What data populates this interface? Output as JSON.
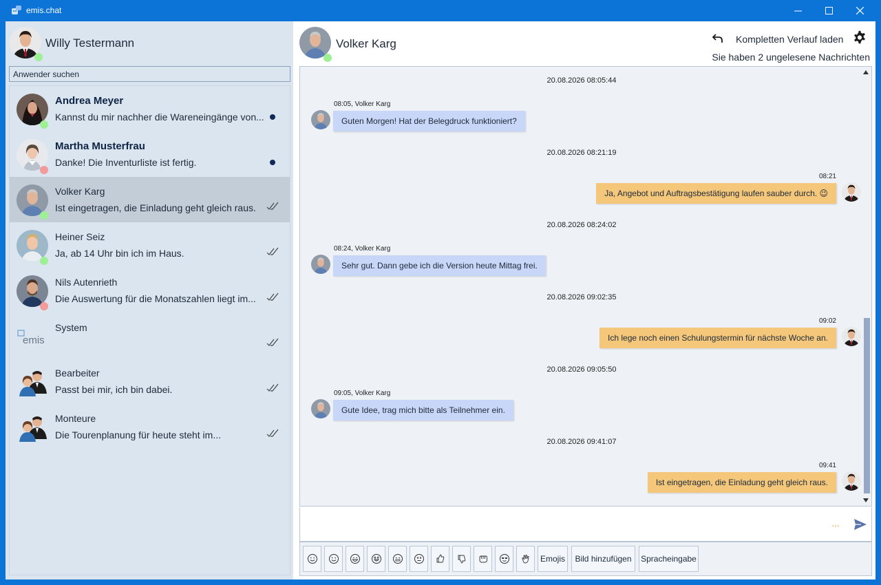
{
  "window": {
    "title": "emis.chat"
  },
  "colors": {
    "titlebar": "#0b74d6",
    "sidebar": "#dbe5f0",
    "incoming_bubble": "#c8d6f7",
    "outgoing_bubble": "#f5c77a",
    "online": "#9ef094",
    "offline": "#f49a9a",
    "unread_dot": "#0f2a57"
  },
  "me": {
    "name": "Willy Testermann",
    "status": "online"
  },
  "search": {
    "placeholder": "Anwender suchen"
  },
  "contacts": [
    {
      "name": "Andrea Meyer",
      "message": "Kannst du mir nachher die Wareneingänge von...",
      "status": "online",
      "unread": true,
      "bold": true,
      "avatar": "woman-dark"
    },
    {
      "name": "Martha Musterfrau",
      "message": "Danke! Die Inventurliste ist fertig.",
      "status": "offline",
      "unread": true,
      "bold": true,
      "avatar": "woman-light"
    },
    {
      "name": "Volker Karg",
      "message": "Ist eingetragen, die Einladung geht gleich raus.",
      "status": "online",
      "unread": false,
      "selected": true,
      "avatar": "man-grey"
    },
    {
      "name": "Heiner Seiz",
      "message": "Ja, ab 14 Uhr bin ich im Haus.",
      "status": "online",
      "unread": false,
      "avatar": "man-blond"
    },
    {
      "name": "Nils Autenrieth",
      "message": "Die Auswertung für die Monatszahlen liegt im...",
      "status": "offline",
      "unread": false,
      "avatar": "man-beard"
    },
    {
      "name": "System",
      "message": "",
      "status": "none",
      "unread": false,
      "avatar": "emis-logo",
      "logo_text": "emis"
    },
    {
      "name": "Bearbeiter",
      "message": "Passt bei mir, ich bin dabei.",
      "status": "none",
      "unread": false,
      "avatar": "group-icon"
    },
    {
      "name": "Monteure",
      "message": "Die Tourenplanung für heute steht im...",
      "status": "none",
      "unread": false,
      "avatar": "group-icon"
    }
  ],
  "chat": {
    "partner": "Volker Karg",
    "partner_status": "online",
    "history_label": "Kompletten Verlauf laden",
    "unread_info": "Sie haben 2 ungelesene Nachrichten",
    "messages": [
      {
        "timestamp": "20.08.2026 08:05:44",
        "direction": "in",
        "meta": "08:05, Volker Karg",
        "text": "Guten Morgen! Hat der Belegdruck funktioniert?"
      },
      {
        "timestamp": "20.08.2026 08:21:19",
        "direction": "out",
        "meta": "08:21",
        "text": "Ja, Angebot und Auftragsbestätigung laufen sauber durch. 😉"
      },
      {
        "timestamp": "20.08.2026 08:24:02",
        "direction": "in",
        "meta": "08:24, Volker Karg",
        "text": "Sehr gut. Dann gebe ich die Version heute Mittag frei."
      },
      {
        "timestamp": "20.08.2026 09:02:35",
        "direction": "out",
        "meta": "09:02",
        "text": "Ich lege noch einen Schulungstermin für nächste Woche an."
      },
      {
        "timestamp": "20.08.2026 09:05:50",
        "direction": "in",
        "meta": "09:05, Volker Karg",
        "text": "Gute Idee, trag mich bitte als Teilnehmer ein."
      },
      {
        "timestamp": "20.08.2026 09:41:07",
        "direction": "out",
        "meta": "09:41",
        "text": "Ist eingetragen, die Einladung geht gleich raus."
      }
    ]
  },
  "composer": {
    "typing_indicator": "···"
  },
  "toolbar": {
    "emoji_buttons": [
      "smile",
      "wink",
      "laugh",
      "surprised",
      "grin",
      "dizzy",
      "thumbs-up",
      "thumbs-down",
      "fist",
      "sunglasses",
      "clap"
    ],
    "emojis_label": "Emojis",
    "image_label": "Bild hinzufügen",
    "voice_label": "Spracheingabe"
  }
}
